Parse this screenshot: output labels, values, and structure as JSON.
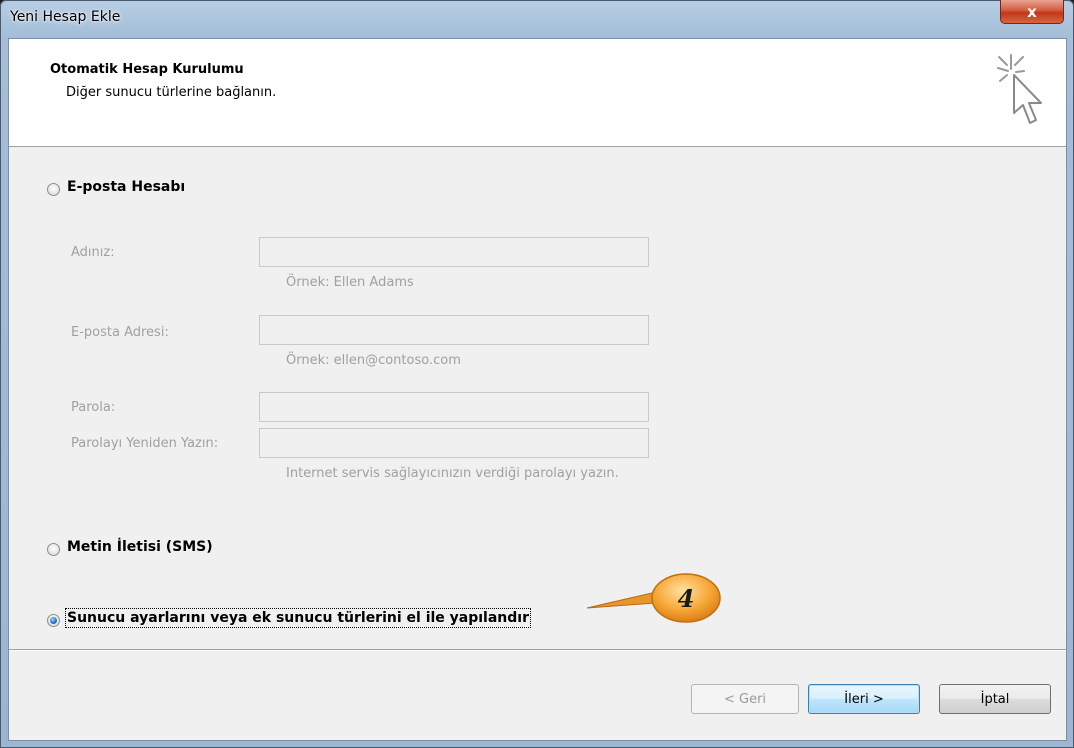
{
  "window": {
    "title": "Yeni Hesap Ekle",
    "close_glyph": "x"
  },
  "header": {
    "title": "Otomatik Hesap Kurulumu",
    "subtitle": "Diğer sunucu türlerine bağlanın.",
    "icon": "wizard-cursor-sparkle-icon"
  },
  "options": {
    "email": {
      "label": "E-posta Hesabı",
      "checked": false
    },
    "sms": {
      "label": "Metin İletisi (SMS)",
      "checked": false
    },
    "manual": {
      "label": "Sunucu ayarlarını veya ek sunucu türlerini el ile yapılandır",
      "checked": true
    }
  },
  "form": {
    "name_label": "Adınız:",
    "name_hint": "Örnek: Ellen Adams",
    "email_label": "E-posta Adresi:",
    "email_hint": "Örnek: ellen@contoso.com",
    "password_label": "Parola:",
    "password_confirm_label": "Parolayı Yeniden Yazın:",
    "password_hint": "Internet servis sağlayıcınızın verdiği parolayı yazın."
  },
  "callout": {
    "number": "4",
    "color": "#f5a623"
  },
  "buttons": {
    "back": "< Geri",
    "next": "İleri >",
    "cancel": "İptal"
  }
}
